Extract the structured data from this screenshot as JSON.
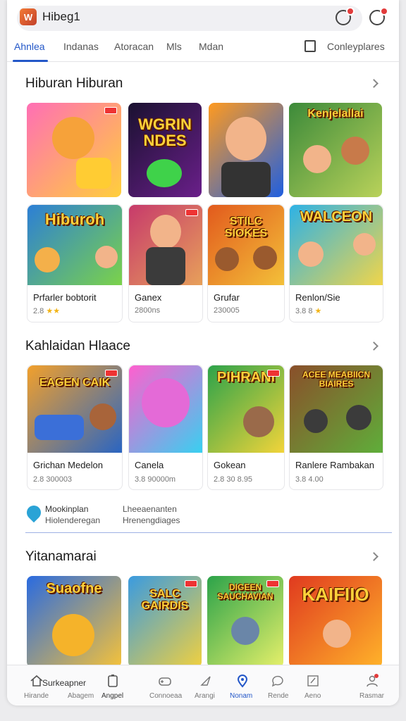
{
  "app": {
    "title": "Hibeg1",
    "logo_text": "W"
  },
  "tabs": [
    "Ahnlea",
    "Indanas",
    "Atoracan",
    "Mls",
    "Mdan"
  ],
  "tab_right_label": "Conleyplares",
  "sections": [
    {
      "title": "Hiburan Hiburan",
      "tiles": [
        {
          "banner": "",
          "name": "",
          "meta": "",
          "colors": [
            "#ff6fb5",
            "#ffcf3b"
          ]
        },
        {
          "banner": "WGRIN NDES",
          "name": "",
          "meta": "",
          "colors": [
            "#1a1130",
            "#6a1f8a"
          ]
        },
        {
          "banner": "",
          "name": "",
          "meta": "",
          "colors": [
            "#ff9a1f",
            "#1f5fe0"
          ]
        },
        {
          "banner": "Kenjelallai",
          "name": "",
          "meta": "",
          "colors": [
            "#3c8a3a",
            "#b9d25a"
          ]
        }
      ]
    },
    {
      "title": "",
      "cards": [
        {
          "banner": "Hiburoh",
          "name": "Prfarler bobtorit",
          "meta": "2.8 ★★",
          "colors": [
            "#2c7fd6",
            "#7bd24a"
          ]
        },
        {
          "banner": "",
          "name": "Ganex",
          "meta": "2800ns",
          "colors": [
            "#c73a6b",
            "#e7a05a"
          ]
        },
        {
          "banner": "STILC SIOKES",
          "name": "Grufar",
          "meta": "230005",
          "colors": [
            "#e25a1d",
            "#f3c039"
          ]
        },
        {
          "banner": "WALCEON",
          "name": "Renlon/Sie",
          "meta": "3.8 8 ★",
          "colors": [
            "#2db2e6",
            "#f0d54a"
          ]
        }
      ]
    },
    {
      "title": "Kahlaidan Hlaace",
      "cards": [
        {
          "banner": "EAGEN CAIK",
          "name": "Grichan Medelon",
          "meta": "2.8 300003",
          "colors": [
            "#f2a02b",
            "#2a65c2"
          ]
        },
        {
          "banner": "",
          "name": "Canela",
          "meta": "3.8 90000m",
          "colors": [
            "#ff5fcf",
            "#38d0f0"
          ]
        },
        {
          "banner": "PIHRANI",
          "name": "Gokean",
          "meta": "2.8 30 8.95",
          "colors": [
            "#2ca34a",
            "#f2d43a"
          ]
        },
        {
          "banner": "ACEE MEABIICN BIAIRES",
          "name": "Ranlere Rambakan",
          "meta": "3.8 4.00",
          "colors": [
            "#8a4f2a",
            "#5fae3a"
          ]
        }
      ]
    },
    {
      "title": "Yitanamarai",
      "tiles": [
        {
          "banner": "Suaofne",
          "colors": [
            "#2a6be0",
            "#f5c23a"
          ]
        },
        {
          "banner": "SALC GAIRDIS",
          "colors": [
            "#3a9be0",
            "#f0d040"
          ]
        },
        {
          "banner": "DIGEEN SAUCHAVIAN",
          "colors": [
            "#2ca34a",
            "#e6f06a"
          ]
        },
        {
          "banner": "KAIFIIO",
          "colors": [
            "#e03a1f",
            "#ffb32a"
          ]
        }
      ]
    }
  ],
  "info": {
    "line1": "Mookinplan",
    "line2": "Hiolenderegan",
    "right1": "Lheeaenanten",
    "right2": "Hrenengdiages"
  },
  "bottom_nav": [
    {
      "icon": "home-icon",
      "label": "Hirande"
    },
    {
      "icon": "",
      "label": "Abagem"
    },
    {
      "icon": "clipboard-icon",
      "label": "Angpel"
    },
    {
      "icon": "gamepad-icon",
      "label": "Connoeaa"
    },
    {
      "icon": "compass-icon",
      "label": "Arangi"
    },
    {
      "icon": "location-icon",
      "label": "Nonam"
    },
    {
      "icon": "chat-icon",
      "label": "Rende"
    },
    {
      "icon": "edit-icon",
      "label": "Aeno"
    },
    {
      "icon": "profile-icon",
      "label": "Rasmar"
    }
  ],
  "bottom_nav_overlay": "Surkeapner",
  "accent": "#2357c8"
}
